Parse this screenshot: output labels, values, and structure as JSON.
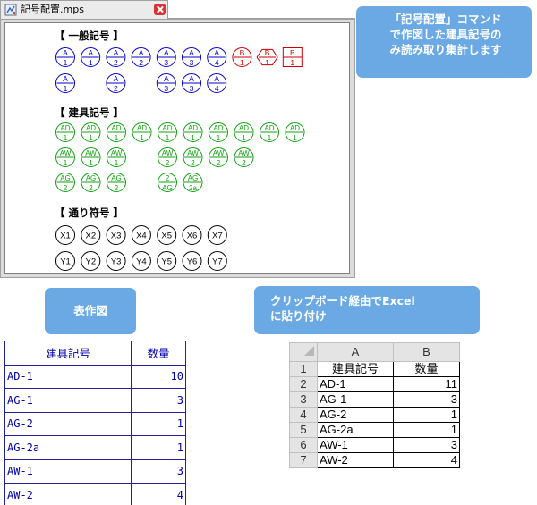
{
  "window": {
    "tab_title": "記号配置.mps"
  },
  "canvas": {
    "sections": [
      {
        "title": "【 一般記号 】"
      },
      {
        "title": "【 建具記号 】"
      },
      {
        "title": "【 通り符号 】"
      }
    ],
    "general_symbols_row1": [
      {
        "top": "A",
        "bottom": "1",
        "color": "#0000cc",
        "shape": "circle"
      },
      {
        "top": "A",
        "bottom": "1",
        "color": "#0000cc",
        "shape": "circle"
      },
      {
        "top": "A",
        "bottom": "2",
        "color": "#0000cc",
        "shape": "circle"
      },
      {
        "top": "A",
        "bottom": "2",
        "color": "#0000cc",
        "shape": "circle"
      },
      {
        "top": "A",
        "bottom": "3",
        "color": "#0000cc",
        "shape": "circle"
      },
      {
        "top": "A",
        "bottom": "3",
        "color": "#0000cc",
        "shape": "circle"
      },
      {
        "top": "A",
        "bottom": "4",
        "color": "#0000cc",
        "shape": "circle"
      },
      {
        "top": "B",
        "bottom": "1",
        "color": "#cc0000",
        "shape": "circle"
      },
      {
        "top": "B",
        "bottom": "1",
        "color": "#cc0000",
        "shape": "hexagon"
      },
      {
        "top": "B",
        "bottom": "1",
        "color": "#cc0000",
        "shape": "square"
      }
    ],
    "general_symbols_row2": [
      {
        "top": "A",
        "bottom": "1",
        "color": "#0000cc",
        "shape": "circle",
        "col": 0
      },
      {
        "top": "A",
        "bottom": "2",
        "color": "#0000cc",
        "shape": "circle",
        "col": 2
      },
      {
        "top": "A",
        "bottom": "3",
        "color": "#0000cc",
        "shape": "circle",
        "col": 4
      },
      {
        "top": "A",
        "bottom": "3",
        "color": "#0000cc",
        "shape": "circle",
        "col": 5
      },
      {
        "top": "A",
        "bottom": "4",
        "color": "#0000cc",
        "shape": "circle",
        "col": 6
      }
    ],
    "fitting_row1": [
      {
        "top": "AD",
        "bottom": "1"
      },
      {
        "top": "AD",
        "bottom": "1"
      },
      {
        "top": "AD",
        "bottom": "1"
      },
      {
        "top": "AD",
        "bottom": "1"
      },
      {
        "top": "AD",
        "bottom": "1"
      },
      {
        "top": "AD",
        "bottom": "1"
      },
      {
        "top": "AD",
        "bottom": "1"
      },
      {
        "top": "AD",
        "bottom": "1"
      },
      {
        "top": "AD",
        "bottom": "1"
      },
      {
        "top": "AD",
        "bottom": "1"
      }
    ],
    "fitting_row2": [
      {
        "top": "AW",
        "bottom": "1",
        "col": 0
      },
      {
        "top": "AW",
        "bottom": "1",
        "col": 1
      },
      {
        "top": "AW",
        "bottom": "1",
        "col": 2
      },
      {
        "top": "AW",
        "bottom": "2",
        "col": 4
      },
      {
        "top": "AW",
        "bottom": "2",
        "col": 5
      },
      {
        "top": "AW",
        "bottom": "2",
        "col": 6
      },
      {
        "top": "AW",
        "bottom": "2",
        "col": 7
      }
    ],
    "fitting_row3": [
      {
        "top": "AG",
        "bottom": "2",
        "col": 0
      },
      {
        "top": "AG",
        "bottom": "2",
        "col": 1
      },
      {
        "top": "AG",
        "bottom": "2",
        "col": 2
      },
      {
        "top": "2",
        "bottom": "AG",
        "col": 4
      },
      {
        "top": "AG",
        "bottom": "2a",
        "col": 5
      }
    ],
    "fitting_color": "#11a011",
    "grid_row1": [
      "X1",
      "X2",
      "X3",
      "X4",
      "X5",
      "X6",
      "X7"
    ],
    "grid_row2": [
      "Y1",
      "Y2",
      "Y3",
      "Y4",
      "Y5",
      "Y6",
      "Y7"
    ]
  },
  "notes": {
    "main_lines": [
      "「記号配置」コマンド",
      "で作図した建具記号の",
      "み読み取り集計します"
    ],
    "table_label": "表作図",
    "clipboard_lines": [
      "クリップボード経由でExcel",
      "に貼り付け"
    ]
  },
  "drawn_table": {
    "headers": [
      "建具記号",
      "数量"
    ],
    "rows": [
      [
        "AD-1",
        "10"
      ],
      [
        "AG-1",
        "3"
      ],
      [
        "AG-2",
        "1"
      ],
      [
        "AG-2a",
        "1"
      ],
      [
        "AW-1",
        "3"
      ],
      [
        "AW-2",
        "4"
      ]
    ]
  },
  "excel": {
    "columns": [
      "A",
      "B"
    ],
    "row_numbers": [
      "1",
      "2",
      "3",
      "4",
      "5",
      "6",
      "7"
    ],
    "cells": [
      [
        "建具記号",
        "数量"
      ],
      [
        "AD-1",
        "11"
      ],
      [
        "AG-1",
        "3"
      ],
      [
        "AG-2",
        "1"
      ],
      [
        "AG-2a",
        "1"
      ],
      [
        "AW-1",
        "3"
      ],
      [
        "AW-2",
        "4"
      ]
    ]
  }
}
